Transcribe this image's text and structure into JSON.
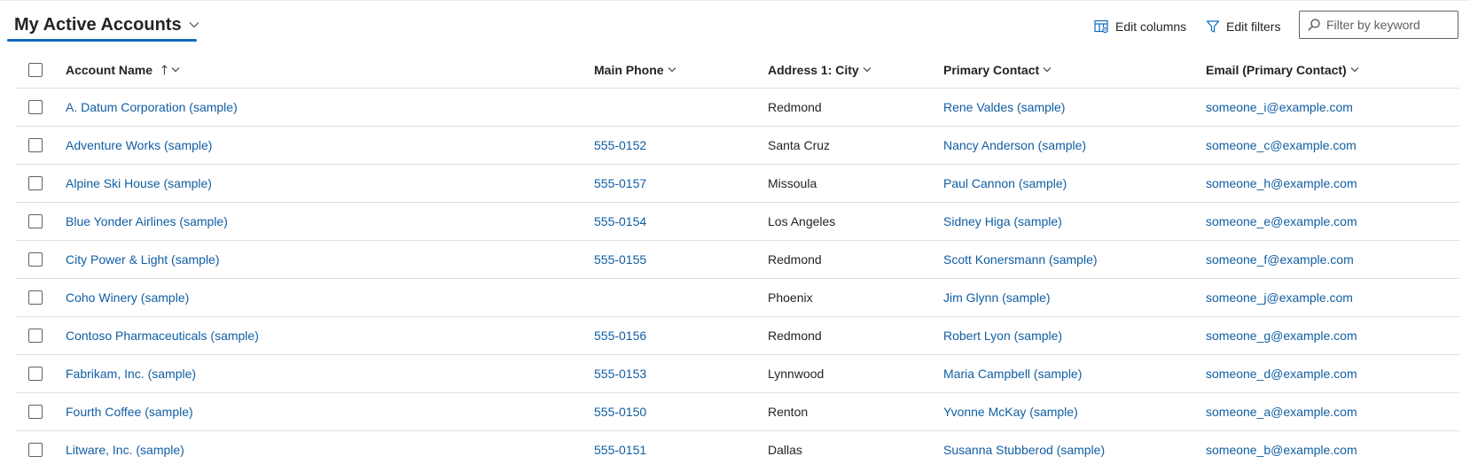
{
  "view": {
    "title": "My Active Accounts"
  },
  "commands": {
    "edit_columns": "Edit columns",
    "edit_filters": "Edit filters"
  },
  "filter": {
    "placeholder": "Filter by keyword",
    "value": ""
  },
  "columns": {
    "account_name": "Account Name",
    "main_phone": "Main Phone",
    "city": "Address 1: City",
    "primary_contact": "Primary Contact",
    "email": "Email (Primary Contact)"
  },
  "rows": [
    {
      "account_name": "A. Datum Corporation (sample)",
      "main_phone": "",
      "city": "Redmond",
      "primary_contact": "Rene Valdes (sample)",
      "email": "someone_i@example.com"
    },
    {
      "account_name": "Adventure Works (sample)",
      "main_phone": "555-0152",
      "city": "Santa Cruz",
      "primary_contact": "Nancy Anderson (sample)",
      "email": "someone_c@example.com"
    },
    {
      "account_name": "Alpine Ski House (sample)",
      "main_phone": "555-0157",
      "city": "Missoula",
      "primary_contact": "Paul Cannon (sample)",
      "email": "someone_h@example.com"
    },
    {
      "account_name": "Blue Yonder Airlines (sample)",
      "main_phone": "555-0154",
      "city": "Los Angeles",
      "primary_contact": "Sidney Higa (sample)",
      "email": "someone_e@example.com"
    },
    {
      "account_name": "City Power & Light (sample)",
      "main_phone": "555-0155",
      "city": "Redmond",
      "primary_contact": "Scott Konersmann (sample)",
      "email": "someone_f@example.com"
    },
    {
      "account_name": "Coho Winery (sample)",
      "main_phone": "",
      "city": "Phoenix",
      "primary_contact": "Jim Glynn (sample)",
      "email": "someone_j@example.com"
    },
    {
      "account_name": "Contoso Pharmaceuticals (sample)",
      "main_phone": "555-0156",
      "city": "Redmond",
      "primary_contact": "Robert Lyon (sample)",
      "email": "someone_g@example.com"
    },
    {
      "account_name": "Fabrikam, Inc. (sample)",
      "main_phone": "555-0153",
      "city": "Lynnwood",
      "primary_contact": "Maria Campbell (sample)",
      "email": "someone_d@example.com"
    },
    {
      "account_name": "Fourth Coffee (sample)",
      "main_phone": "555-0150",
      "city": "Renton",
      "primary_contact": "Yvonne McKay (sample)",
      "email": "someone_a@example.com"
    },
    {
      "account_name": "Litware, Inc. (sample)",
      "main_phone": "555-0151",
      "city": "Dallas",
      "primary_contact": "Susanna Stubberod (sample)",
      "email": "someone_b@example.com"
    }
  ],
  "colors": {
    "accent": "#0f6cbd",
    "link": "#115ea3",
    "text": "#242424",
    "divider": "#e1dfdd"
  },
  "icons": {
    "view_selector": "chevron-down-icon",
    "edit_columns": "edit-columns-icon",
    "edit_filters": "funnel-icon",
    "filter": "search-icon",
    "sort": "sort-ascending-icon"
  }
}
